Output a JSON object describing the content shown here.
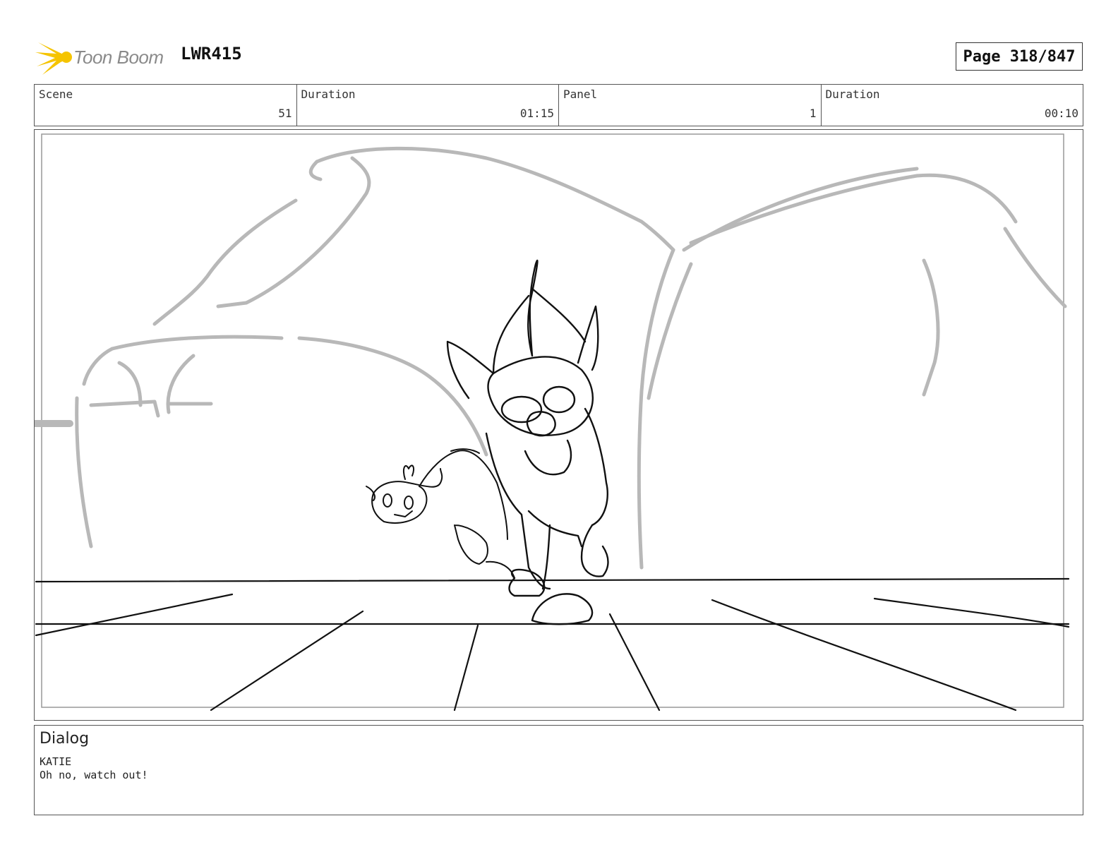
{
  "header": {
    "logo_text": "Toon Boom",
    "production_code": "LWR415",
    "page_label": "Page 318/847"
  },
  "info": {
    "scene_label": "Scene",
    "scene_value": "51",
    "scene_duration_label": "Duration",
    "scene_duration_value": "01:15",
    "panel_label": "Panel",
    "panel_value": "1",
    "panel_duration_label": "Duration",
    "panel_duration_value": "00:10"
  },
  "dialog": {
    "title": "Dialog",
    "speaker": "KATIE",
    "line": "Oh no, watch out!"
  },
  "colors": {
    "logo_accent": "#f5c400",
    "sketch_background": "#b8b8b8",
    "sketch_foreground": "#111111"
  }
}
